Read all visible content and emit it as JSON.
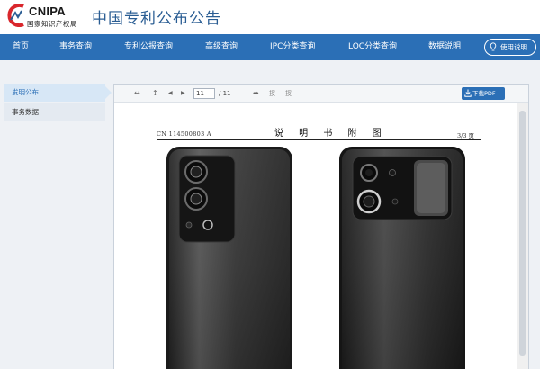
{
  "header": {
    "logo_text": "CNIPA",
    "logo_subtext": "国家知识产权局",
    "site_title": "中国专利公布公告"
  },
  "nav": {
    "items": [
      {
        "label": "首页"
      },
      {
        "label": "事务查询"
      },
      {
        "label": "专利公报查询"
      },
      {
        "label": "高级查询"
      },
      {
        "label": "IPC分类查询"
      },
      {
        "label": "LOC分类查询"
      },
      {
        "label": "数据说明"
      }
    ],
    "help_label": "使用说明"
  },
  "sidebar": {
    "items": [
      {
        "label": "发明公布",
        "active": true
      },
      {
        "label": "事务数据",
        "active": false
      }
    ]
  },
  "viewer": {
    "current_page": "11",
    "total_pages": "/ 11",
    "download_label": "下载PDF",
    "toolbar_glyphs": {
      "fit_width": "↔",
      "fit_height": "↕",
      "prev": "◀",
      "next": "▶",
      "share": "➦",
      "rotate_left": "扠",
      "rotate_right": "扠"
    }
  },
  "document": {
    "publication_number": "CN 114500803 A",
    "section_title": "说 明 书 附 图",
    "page_indicator": "3/3 页"
  },
  "colors": {
    "nav_bg": "#2b6fb6",
    "title": "#2a5d93",
    "logo_red": "#d9262c"
  }
}
